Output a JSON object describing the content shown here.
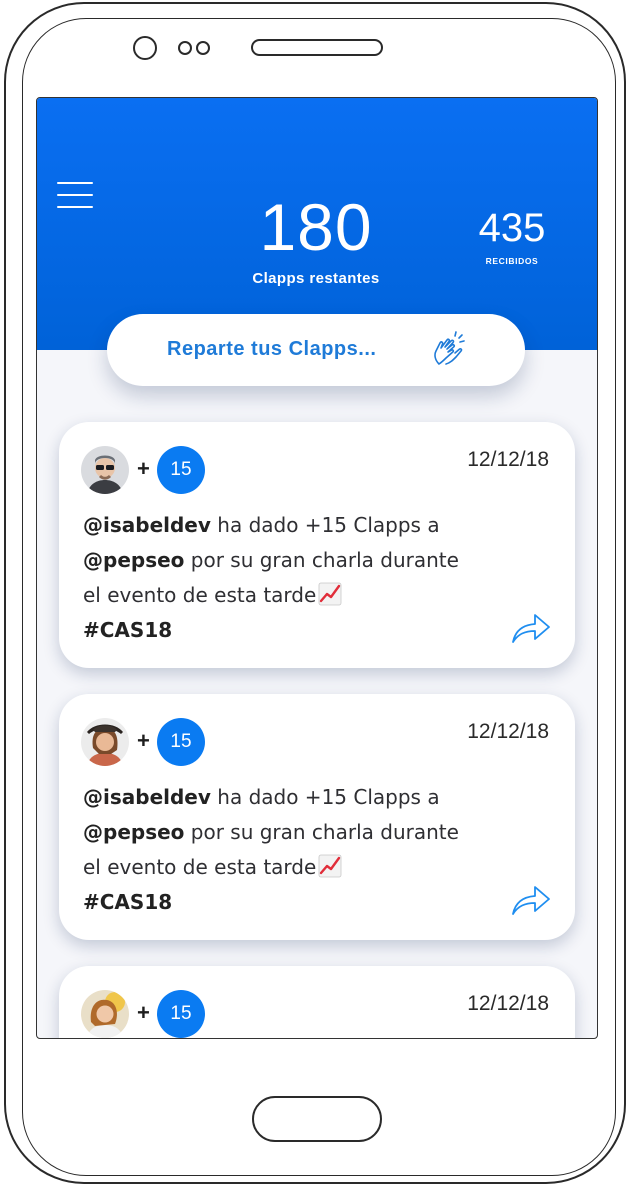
{
  "header": {
    "remaining_value": "180",
    "remaining_label": "Clapps restantes",
    "received_value": "435",
    "received_label": "RECIBIDOS"
  },
  "cta": {
    "label": "Reparte tus Clapps...",
    "icon": "clapping-hands-icon"
  },
  "colors": {
    "primary": "#0a6ff2",
    "accent_text": "#1f7bd8",
    "badge": "#0a7bf2"
  },
  "feed": [
    {
      "badge": "15",
      "date": "12/12/18",
      "from": "@isabeldev",
      "text1": " ha dado +15 Clapps a ",
      "to": "@pepseo",
      "text2": " por su gran charla durante el evento de esta tarde",
      "hashtag": "#CAS18"
    },
    {
      "badge": "15",
      "date": "12/12/18",
      "from": "@isabeldev",
      "text1": " ha dado +15 Clapps a ",
      "to": "@pepseo",
      "text2": " por su gran charla durante el evento de esta tarde",
      "hashtag": "#CAS18"
    },
    {
      "badge": "15",
      "date": "12/12/18"
    }
  ]
}
